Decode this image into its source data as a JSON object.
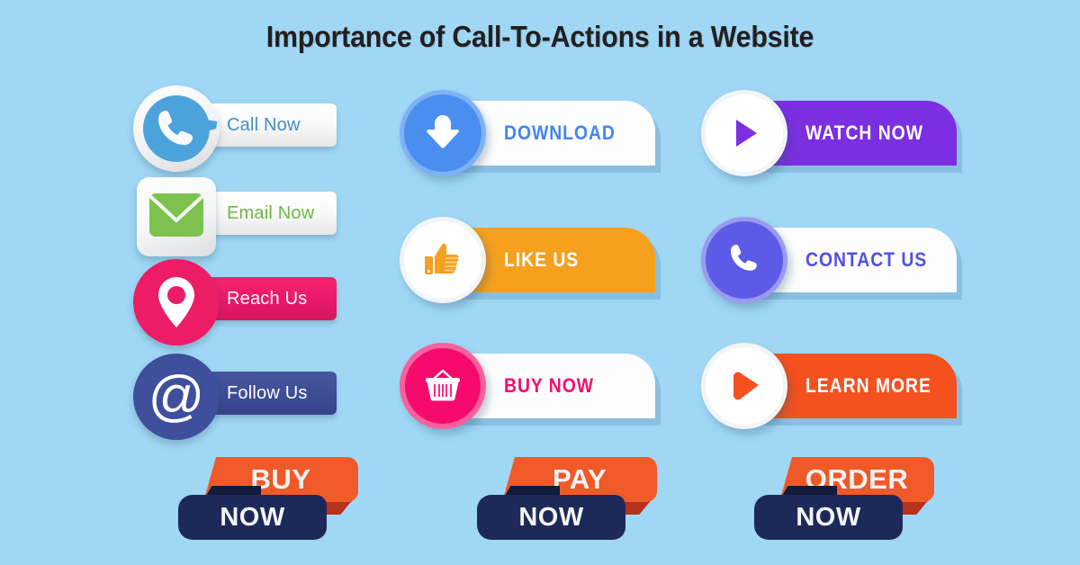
{
  "page": {
    "title": "Importance of Call-To-Actions in a Website",
    "background_color": "#9FD7F5"
  },
  "columns": {
    "column1": {
      "style": "glossy",
      "buttons": [
        {
          "label": "Call Now",
          "icon": "phone-icon",
          "icon_shape": "speech-bubble-circle",
          "icon_color": "#4CA3DC",
          "bar_style": "light",
          "text_color": "#3E8FC6"
        },
        {
          "label": "Email Now",
          "icon": "envelope-icon",
          "icon_shape": "rounded-square",
          "icon_color": "#7DC24E",
          "bar_style": "light",
          "text_color": "#6FB843"
        },
        {
          "label": "Reach Us",
          "icon": "map-pin-icon",
          "icon_shape": "circle",
          "icon_color": "#ED1C67",
          "bar_style": "pink",
          "text_color": "#FFFFFF"
        },
        {
          "label": "Follow Us",
          "icon": "at-sign-icon",
          "icon_shape": "circle",
          "icon_color": "#3F4F9B",
          "bar_style": "navy",
          "text_color": "#FFFFFF"
        }
      ]
    },
    "column2": {
      "style": "flat-notched",
      "buttons": [
        {
          "label": "DOWNLOAD",
          "icon": "download-arrow-icon",
          "circle_fill": "#4A8FF0",
          "circle_ring": "#7FB2F5",
          "icon_color": "#FFFFFF",
          "plate_color": "#FDFDFD",
          "text_color": "#4285F4"
        },
        {
          "label": "LIKE US",
          "icon": "thumbs-up-icon",
          "circle_fill": "#FFFFFF",
          "circle_ring": "#F2F4F6",
          "icon_color": "#F5A01F",
          "plate_color": "#F5A01F",
          "text_color": "#FFFFFF"
        },
        {
          "label": "BUY NOW",
          "icon": "shopping-basket-icon",
          "circle_fill": "#F60B6C",
          "circle_ring": "#F9609E",
          "icon_color": "#FFFFFF",
          "plate_color": "#FDFDFD",
          "text_color": "#F60B6C"
        }
      ]
    },
    "column3": {
      "style": "flat-notched",
      "buttons": [
        {
          "label": "WATCH NOW",
          "icon": "play-triangle-icon",
          "circle_fill": "#FFFFFF",
          "circle_ring": "#F2F4F6",
          "icon_color": "#7B2FE0",
          "plate_color": "#7B2FE0",
          "text_color": "#FFFFFF"
        },
        {
          "label": "CONTACT US",
          "icon": "phone-icon",
          "circle_fill": "#5B5BE8",
          "circle_ring": "#9A9AF0",
          "icon_color": "#FFFFFF",
          "plate_color": "#FDFDFD",
          "text_color": "#5050E6"
        },
        {
          "label": "LEARN MORE",
          "icon": "arrow-right-icon",
          "circle_fill": "#FFFFFF",
          "circle_ring": "#F2F4F6",
          "icon_color": "#F4511E",
          "plate_color": "#F4511E",
          "text_color": "#FFFFFF"
        }
      ]
    }
  },
  "ribbons": [
    {
      "top_label": "BUY",
      "bottom_label": "NOW",
      "top_color": "#F05A28",
      "bottom_color": "#1D2A59"
    },
    {
      "top_label": "PAY",
      "bottom_label": "NOW",
      "top_color": "#F05A28",
      "bottom_color": "#1D2A59"
    },
    {
      "top_label": "ORDER",
      "bottom_label": "NOW",
      "top_color": "#F05A28",
      "bottom_color": "#1D2A59"
    }
  ]
}
